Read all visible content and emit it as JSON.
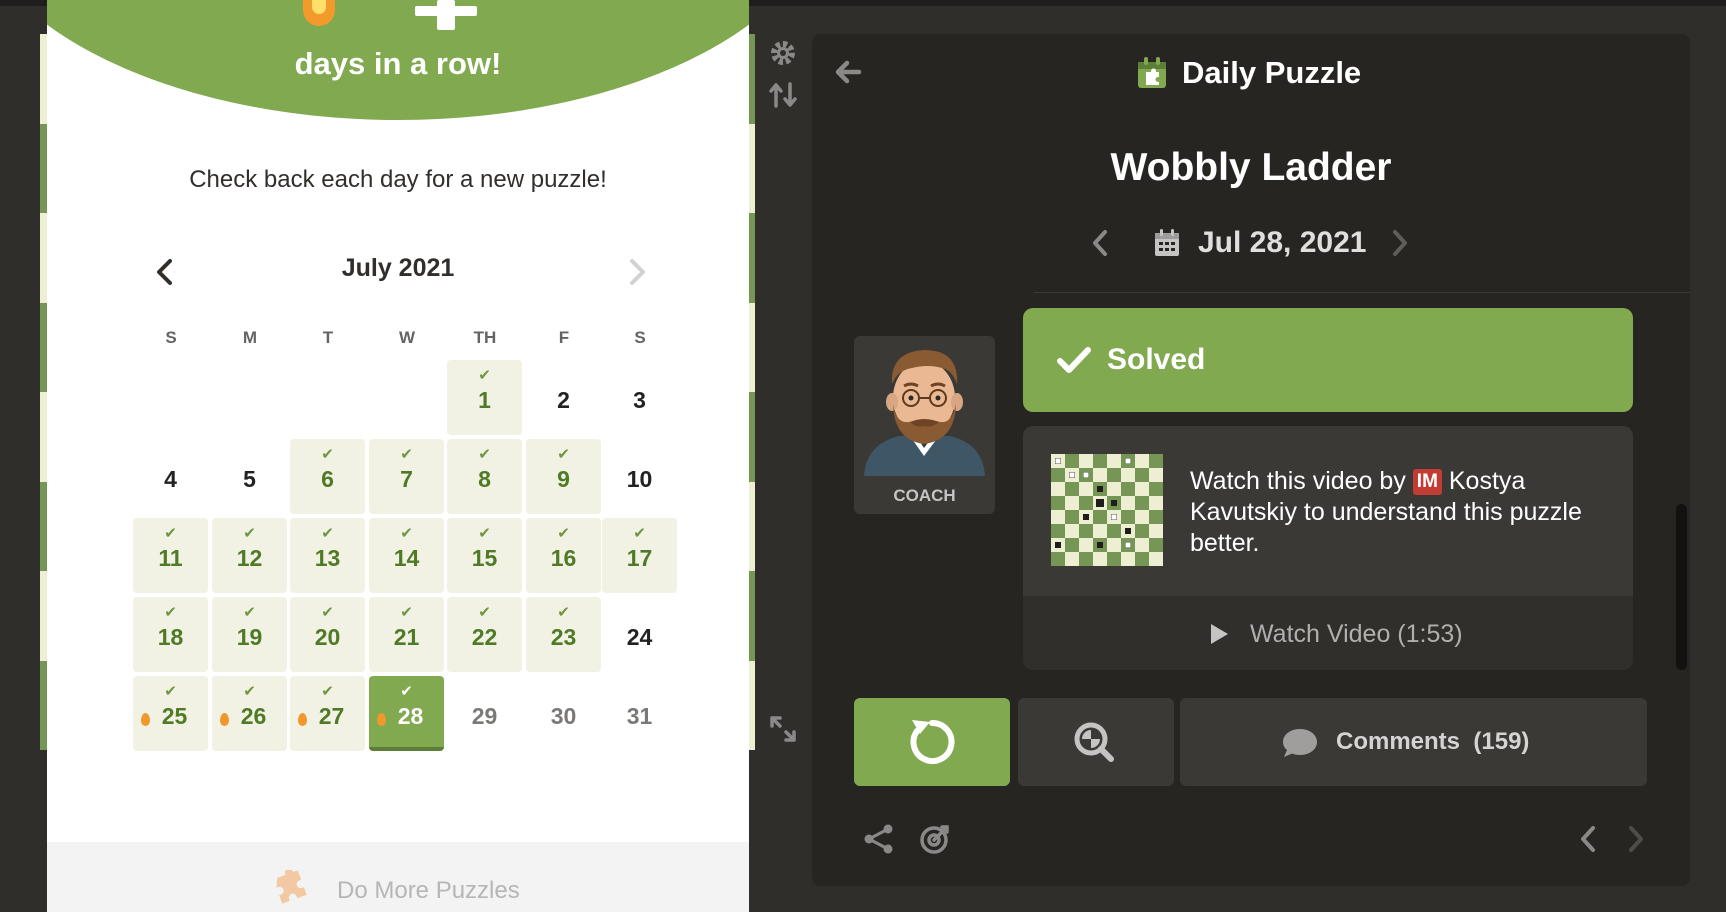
{
  "streak": {
    "label": "days in a row!"
  },
  "calendar": {
    "prompt": "Check back each day for a new puzzle!",
    "month_label": "July 2021",
    "weekdays": [
      "S",
      "M",
      "T",
      "W",
      "TH",
      "F",
      "S"
    ],
    "days": [
      {
        "n": "1",
        "solved": true
      },
      {
        "n": "2"
      },
      {
        "n": "3"
      },
      {
        "n": "4"
      },
      {
        "n": "5"
      },
      {
        "n": "6",
        "solved": true
      },
      {
        "n": "7",
        "solved": true
      },
      {
        "n": "8",
        "solved": true
      },
      {
        "n": "9",
        "solved": true
      },
      {
        "n": "10"
      },
      {
        "n": "11",
        "solved": true
      },
      {
        "n": "12",
        "solved": true
      },
      {
        "n": "13",
        "solved": true
      },
      {
        "n": "14",
        "solved": true
      },
      {
        "n": "15",
        "solved": true
      },
      {
        "n": "16",
        "solved": true
      },
      {
        "n": "17",
        "solved": true
      },
      {
        "n": "18",
        "solved": true
      },
      {
        "n": "19",
        "solved": true
      },
      {
        "n": "20",
        "solved": true
      },
      {
        "n": "21",
        "solved": true
      },
      {
        "n": "22",
        "solved": true
      },
      {
        "n": "23",
        "solved": true
      },
      {
        "n": "24"
      },
      {
        "n": "25",
        "solved": true,
        "streak": true
      },
      {
        "n": "26",
        "solved": true,
        "streak": true
      },
      {
        "n": "27",
        "solved": true,
        "streak": true
      },
      {
        "n": "28",
        "solved": true,
        "streak": true,
        "current": true
      },
      {
        "n": "29",
        "future": true
      },
      {
        "n": "30",
        "future": true
      },
      {
        "n": "31",
        "future": true
      }
    ],
    "first_weekday": 4,
    "more_puzzles_label": "Do More Puzzles"
  },
  "panel": {
    "header_title": "Daily Puzzle",
    "puzzle_title": "Wobbly Ladder",
    "date": "Jul 28, 2021",
    "coach_label": "COACH",
    "solved_label": "Solved",
    "video": {
      "prefix": "Watch this video by",
      "title_badge": "IM",
      "suffix": "Kostya Kavutskiy to understand this puzzle better.",
      "watch_label": "Watch Video (1:53)"
    },
    "comments_label": "Comments",
    "comments_count": "(159)"
  },
  "colors": {
    "accent_green": "#81a94f",
    "solved_day_bg": "#f1f2e3",
    "panel_bg": "#262522",
    "page_bg": "#302e2b",
    "im_badge": "#c33c33"
  },
  "icons": [
    "settings-icon",
    "flip-board-icon",
    "expand-icon",
    "back-arrow-icon",
    "daily-puzzle-icon",
    "calendar-icon",
    "check-icon",
    "play-icon",
    "retry-icon",
    "analysis-icon",
    "comment-icon",
    "share-icon",
    "target-icon",
    "flame-icon",
    "puzzle-piece-icon"
  ]
}
